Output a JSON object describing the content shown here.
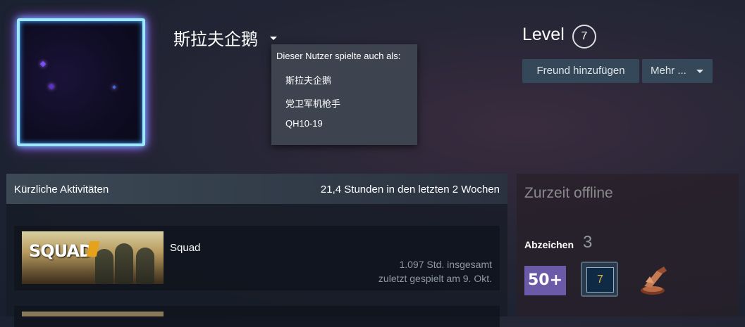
{
  "profile": {
    "persona_name": "斯拉夫企鹅",
    "level_label": "Level",
    "level": "7"
  },
  "aliases_dropdown": {
    "header": "Dieser Nutzer spielte auch als:",
    "items": [
      "斯拉夫企鹅",
      "党卫军机枪手",
      "QH10-19"
    ]
  },
  "actions": {
    "add_friend": "Freund hinzufügen",
    "more": "Mehr ..."
  },
  "recent_activity": {
    "title": "Kürzliche Aktivitäten",
    "hours_summary": "21,4 Stunden in den letzten 2 Wochen",
    "games": [
      {
        "name": "Squad",
        "capsule_logo": "SQUAD",
        "total_hours": "1.097 Std. insgesamt",
        "last_played": "zuletzt gespielt am 9. Okt."
      }
    ]
  },
  "sidebar": {
    "status": "Zurzeit offline",
    "badges_label": "Abzeichen",
    "badges_count": "3",
    "badges": [
      {
        "label": "50+",
        "icon": "50-plus-badge-icon"
      },
      {
        "label": "7",
        "icon": "years-of-service-badge-icon"
      },
      {
        "label": "",
        "icon": "bronze-trophy-badge-icon"
      }
    ]
  },
  "colors": {
    "button_bg": "#35485a",
    "dropdown_bg": "#3d4450",
    "muted_text": "#8f98a0",
    "offline_text": "#898a8b"
  }
}
